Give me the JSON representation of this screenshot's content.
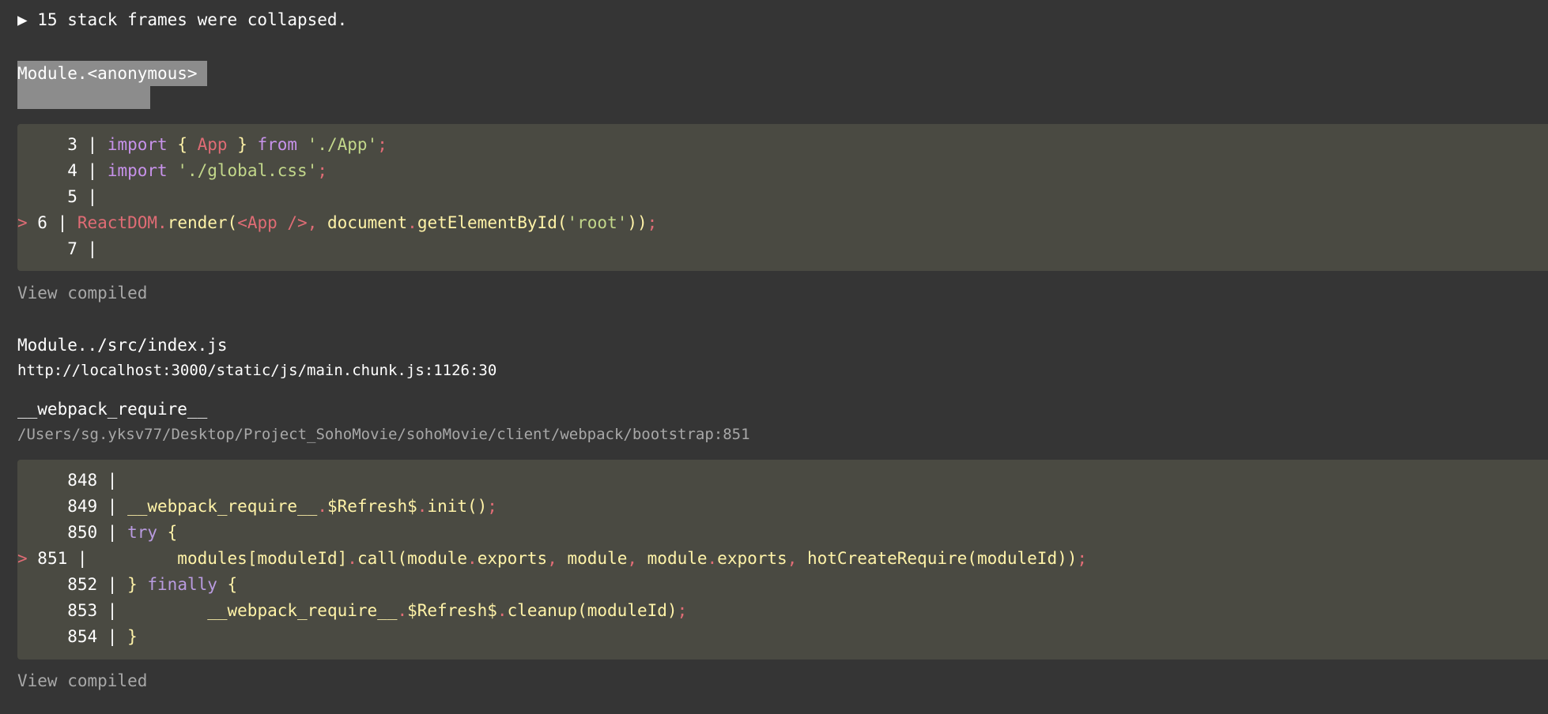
{
  "collapsed_label": "▶ 15 stack frames were collapsed.",
  "frame1": {
    "function_name": "Module.<anonymous>",
    "code_lines": [
      {
        "gutter": "   3 | ",
        "marker": "  ",
        "tokens": [
          {
            "t": "import",
            "c": "kw"
          },
          {
            "t": " ",
            "c": "plain"
          },
          {
            "t": "{",
            "c": "yel"
          },
          {
            "t": " App ",
            "c": "red"
          },
          {
            "t": "}",
            "c": "yel"
          },
          {
            "t": " from ",
            "c": "kw"
          },
          {
            "t": "'./App'",
            "c": "str"
          },
          {
            "t": ";",
            "c": "punct"
          }
        ]
      },
      {
        "gutter": "   4 | ",
        "marker": "  ",
        "tokens": [
          {
            "t": "import",
            "c": "kw"
          },
          {
            "t": " ",
            "c": "plain"
          },
          {
            "t": "'./global.css'",
            "c": "str"
          },
          {
            "t": ";",
            "c": "punct"
          }
        ]
      },
      {
        "gutter": "   5 | ",
        "marker": "  ",
        "tokens": []
      },
      {
        "gutter": " 6 | ",
        "marker": "> ",
        "tokens": [
          {
            "t": "ReactDOM",
            "c": "red"
          },
          {
            "t": ".",
            "c": "punct"
          },
          {
            "t": "render",
            "c": "yel"
          },
          {
            "t": "(",
            "c": "yel"
          },
          {
            "t": "<App />",
            "c": "red"
          },
          {
            "t": ", ",
            "c": "punct"
          },
          {
            "t": "document",
            "c": "yel"
          },
          {
            "t": ".",
            "c": "punct"
          },
          {
            "t": "getElementById",
            "c": "yel"
          },
          {
            "t": "(",
            "c": "yel"
          },
          {
            "t": "'root'",
            "c": "str"
          },
          {
            "t": "))",
            "c": "yel"
          },
          {
            "t": ";",
            "c": "punct"
          }
        ]
      },
      {
        "gutter": "   7 | ",
        "marker": "  ",
        "tokens": []
      }
    ],
    "view_compiled": "View compiled"
  },
  "frame2": {
    "function_name": "Module../src/index.js",
    "location": "http://localhost:3000/static/js/main.chunk.js:1126:30"
  },
  "frame3": {
    "function_name": "__webpack_require__",
    "location": "/Users/sg.yksv77/Desktop/Project_SohoMovie/sohoMovie/client/webpack/bootstrap:851",
    "code_lines": [
      {
        "gutter": "   848 | ",
        "marker": "  ",
        "tokens": []
      },
      {
        "gutter": "   849 | ",
        "marker": "  ",
        "tokens": [
          {
            "t": "__webpack_require__",
            "c": "yel"
          },
          {
            "t": ".",
            "c": "punct"
          },
          {
            "t": "$Refresh$",
            "c": "yel"
          },
          {
            "t": ".",
            "c": "punct"
          },
          {
            "t": "init",
            "c": "yel"
          },
          {
            "t": "()",
            "c": "yel"
          },
          {
            "t": ";",
            "c": "punct"
          }
        ]
      },
      {
        "gutter": "   850 | ",
        "marker": "  ",
        "tokens": [
          {
            "t": "try",
            "c": "kw2"
          },
          {
            "t": " {",
            "c": "yel"
          }
        ]
      },
      {
        "gutter": " 851 | ",
        "marker": "> ",
        "tokens": [
          {
            "t": "        modules",
            "c": "yel"
          },
          {
            "t": "[",
            "c": "yel"
          },
          {
            "t": "moduleId",
            "c": "yel"
          },
          {
            "t": "]",
            "c": "yel"
          },
          {
            "t": ".",
            "c": "punct"
          },
          {
            "t": "call",
            "c": "yel"
          },
          {
            "t": "(",
            "c": "yel"
          },
          {
            "t": "module",
            "c": "yel"
          },
          {
            "t": ".",
            "c": "punct"
          },
          {
            "t": "exports",
            "c": "yel"
          },
          {
            "t": ", ",
            "c": "punct"
          },
          {
            "t": "module",
            "c": "yel"
          },
          {
            "t": ", ",
            "c": "punct"
          },
          {
            "t": "module",
            "c": "yel"
          },
          {
            "t": ".",
            "c": "punct"
          },
          {
            "t": "exports",
            "c": "yel"
          },
          {
            "t": ", ",
            "c": "punct"
          },
          {
            "t": "hotCreateRequire",
            "c": "yel"
          },
          {
            "t": "(",
            "c": "yel"
          },
          {
            "t": "moduleId",
            "c": "yel"
          },
          {
            "t": "))",
            "c": "yel"
          },
          {
            "t": ";",
            "c": "punct"
          }
        ]
      },
      {
        "gutter": "   852 | ",
        "marker": "  ",
        "tokens": [
          {
            "t": "}",
            "c": "yel"
          },
          {
            "t": " finally",
            "c": "kw2"
          },
          {
            "t": " {",
            "c": "yel"
          }
        ]
      },
      {
        "gutter": "   853 | ",
        "marker": "  ",
        "tokens": [
          {
            "t": "        __webpack_require__",
            "c": "yel"
          },
          {
            "t": ".",
            "c": "punct"
          },
          {
            "t": "$Refresh$",
            "c": "yel"
          },
          {
            "t": ".",
            "c": "punct"
          },
          {
            "t": "cleanup",
            "c": "yel"
          },
          {
            "t": "(",
            "c": "yel"
          },
          {
            "t": "moduleId",
            "c": "yel"
          },
          {
            "t": ")",
            "c": "yel"
          },
          {
            "t": ";",
            "c": "punct"
          }
        ]
      },
      {
        "gutter": "   854 | ",
        "marker": "  ",
        "tokens": [
          {
            "t": "}",
            "c": "yel"
          }
        ]
      }
    ],
    "view_compiled": "View compiled"
  }
}
